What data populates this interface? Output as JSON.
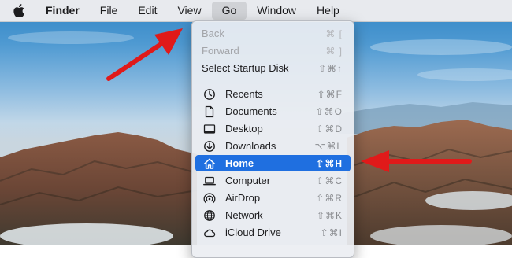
{
  "menubar": {
    "apple": "apple-logo",
    "items": [
      "Finder",
      "File",
      "Edit",
      "View",
      "Go",
      "Window",
      "Help"
    ],
    "active": "Go"
  },
  "go_menu": {
    "top_items": [
      {
        "label": "Back",
        "shortcut": "⌘ [",
        "enabled": false
      },
      {
        "label": "Forward",
        "shortcut": "⌘ ]",
        "enabled": false
      },
      {
        "label": "Select Startup Disk",
        "shortcut": "⇧⌘↑",
        "enabled": true
      }
    ],
    "places": [
      {
        "label": "Recents",
        "shortcut": "⇧⌘F",
        "icon": "clock-icon"
      },
      {
        "label": "Documents",
        "shortcut": "⇧⌘O",
        "icon": "document-icon"
      },
      {
        "label": "Desktop",
        "shortcut": "⇧⌘D",
        "icon": "desktop-icon"
      },
      {
        "label": "Downloads",
        "shortcut": "⌥⌘L",
        "icon": "download-icon"
      },
      {
        "label": "Home",
        "shortcut": "⇧⌘H",
        "icon": "house-icon",
        "selected": true
      },
      {
        "label": "Computer",
        "shortcut": "⇧⌘C",
        "icon": "laptop-icon"
      },
      {
        "label": "AirDrop",
        "shortcut": "⇧⌘R",
        "icon": "airdrop-icon"
      },
      {
        "label": "Network",
        "shortcut": "⇧⌘K",
        "icon": "globe-icon"
      },
      {
        "label": "iCloud Drive",
        "shortcut": "⇧⌘I",
        "icon": "cloud-icon"
      }
    ]
  },
  "colors": {
    "highlight": "#1f6fe0",
    "annotation_arrow": "#e01a1a"
  }
}
